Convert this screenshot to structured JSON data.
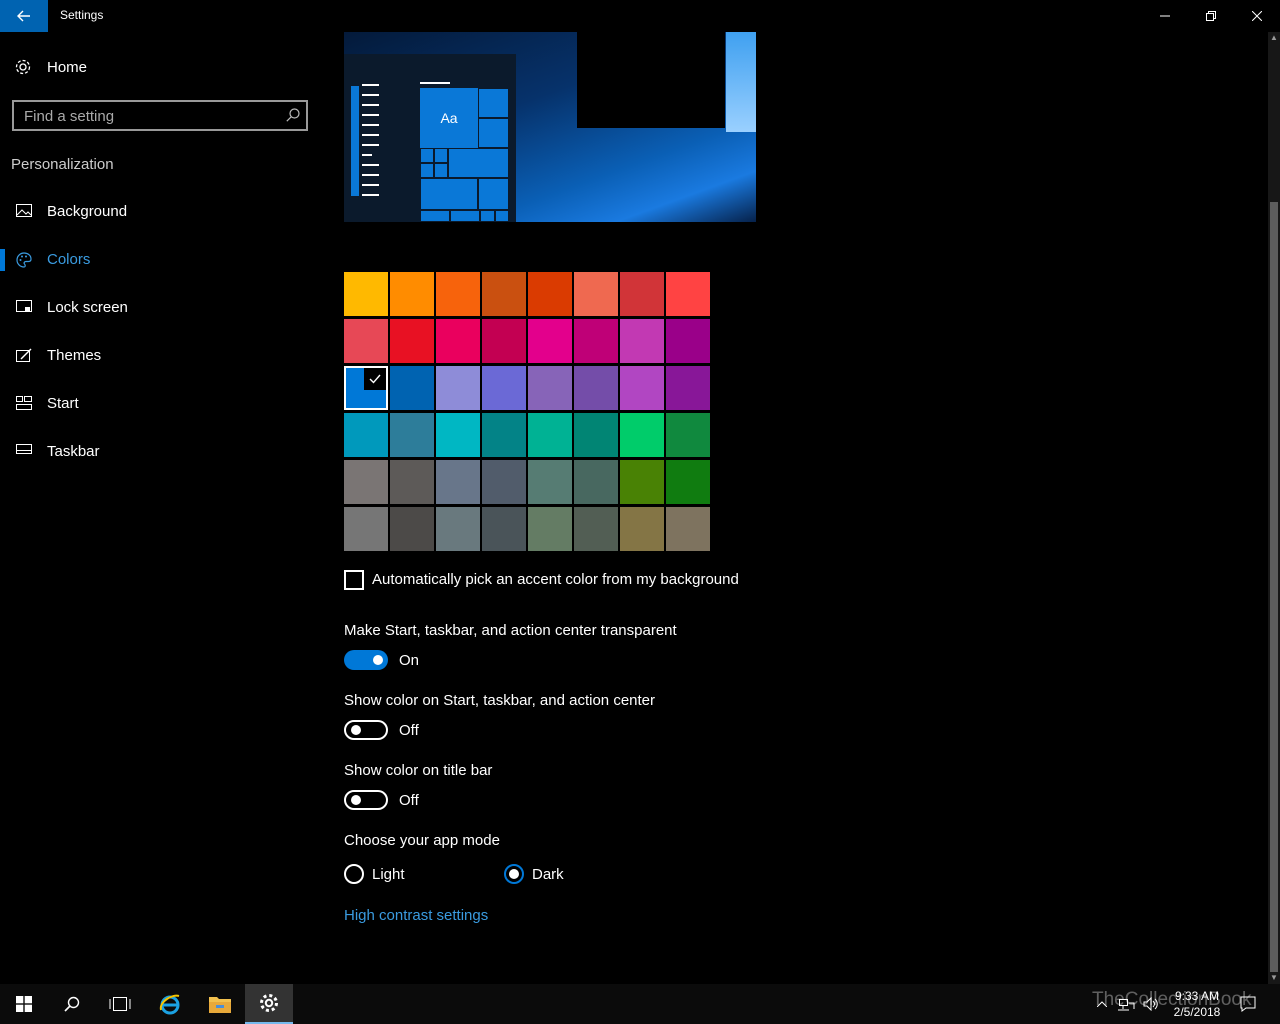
{
  "window": {
    "title": "Settings",
    "back_icon": "arrow-left-icon",
    "minimize_icon": "minimize-icon",
    "restore_icon": "restore-icon",
    "close_icon": "close-icon"
  },
  "sidebar": {
    "home_label": "Home",
    "search_placeholder": "Find a setting",
    "section_title": "Personalization",
    "items": [
      {
        "label": "Background",
        "icon": "image-icon",
        "active": false
      },
      {
        "label": "Colors",
        "icon": "palette-icon",
        "active": true
      },
      {
        "label": "Lock screen",
        "icon": "lock-screen-icon",
        "active": false
      },
      {
        "label": "Themes",
        "icon": "themes-icon",
        "active": false
      },
      {
        "label": "Start",
        "icon": "start-icon",
        "active": false
      },
      {
        "label": "Taskbar",
        "icon": "taskbar-icon",
        "active": false
      }
    ]
  },
  "preview": {
    "sample_text": "Aa"
  },
  "colors": {
    "accent": "#0078d7",
    "link": "#3a9be0",
    "selected_swatch": "#0078d7",
    "swatches": [
      [
        "#ffb900",
        "#ff8c00",
        "#f7630c",
        "#ca5010",
        "#da3b01",
        "#ef6950",
        "#d13438",
        "#ff4343"
      ],
      [
        "#e74856",
        "#e81123",
        "#ea005e",
        "#c30052",
        "#e3008c",
        "#bf0077",
        "#c239b3",
        "#9a0089"
      ],
      [
        "#0078d7",
        "#0063b1",
        "#8e8cd8",
        "#6b69d6",
        "#8764b8",
        "#744da9",
        "#b146c2",
        "#881798"
      ],
      [
        "#0099bc",
        "#2d7d9a",
        "#00b7c3",
        "#038387",
        "#00b294",
        "#018574",
        "#00cc6a",
        "#10893e"
      ],
      [
        "#7a7574",
        "#5d5a58",
        "#68768a",
        "#515c6b",
        "#567c73",
        "#486860",
        "#498205",
        "#107c10"
      ],
      [
        "#767676",
        "#4c4a48",
        "#69797e",
        "#4a5459",
        "#647c64",
        "#525e54",
        "#847545",
        "#7e735f"
      ]
    ]
  },
  "settings": {
    "auto_pick_label": "Automatically pick an accent color from my background",
    "auto_pick_checked": false,
    "transparent_label": "Make Start, taskbar, and action center transparent",
    "transparent_state": "On",
    "show_color_start_label": "Show color on Start, taskbar, and action center",
    "show_color_start_state": "Off",
    "show_color_titlebar_label": "Show color on title bar",
    "show_color_titlebar_state": "Off",
    "app_mode_label": "Choose your app mode",
    "app_mode_options": [
      "Light",
      "Dark"
    ],
    "app_mode_selected": "Dark",
    "high_contrast_link": "High contrast settings"
  },
  "taskbar": {
    "buttons": [
      "windows-start-icon",
      "search-icon",
      "task-view-icon",
      "internet-explorer-icon",
      "file-explorer-icon",
      "settings-gear-icon"
    ],
    "active": "settings-gear-icon",
    "tray_icons": [
      "chevron-up-icon",
      "network-icon",
      "volume-icon",
      "action-center-icon"
    ],
    "time": "9:33 AM",
    "date": "2/5/2018",
    "watermark": "TheCollectionBook"
  }
}
